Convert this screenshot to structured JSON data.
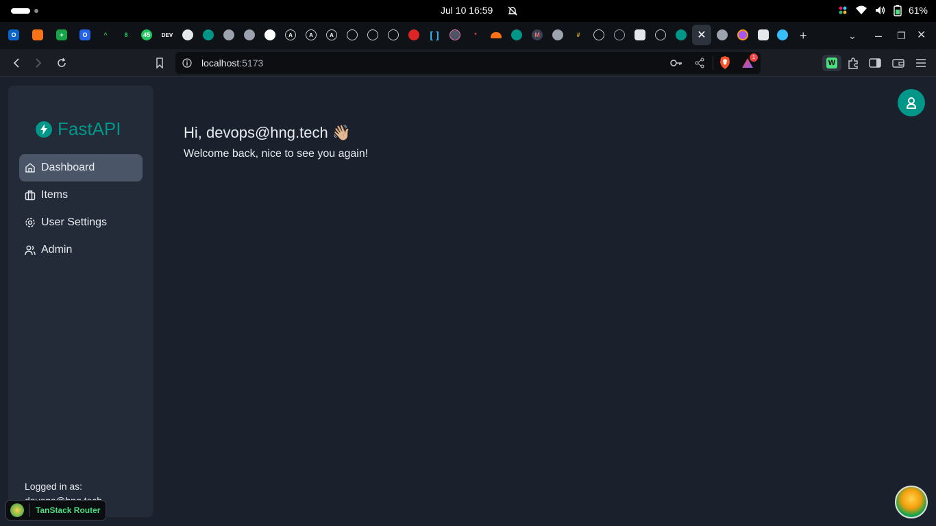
{
  "os": {
    "datetime": "Jul 10  16:59",
    "battery": "61%"
  },
  "browser": {
    "url_host": "localhost",
    "url_port": ":5173",
    "brave_badge": "1"
  },
  "app": {
    "brand": "FastAPI",
    "nav": [
      {
        "label": "Dashboard",
        "icon": "home-icon",
        "active": true
      },
      {
        "label": "Items",
        "icon": "briefcase-icon",
        "active": false
      },
      {
        "label": "User Settings",
        "icon": "gear-icon",
        "active": false
      },
      {
        "label": "Admin",
        "icon": "users-icon",
        "active": false
      }
    ],
    "logged_in_label": "Logged in as:",
    "logged_in_user": "devops@hng.tech",
    "greeting": "Hi, devops@hng.tech 👋🏼",
    "welcome": "Welcome back, nice to see you again!",
    "tanstack_label": "TanStack Router",
    "accent": "#009688"
  }
}
